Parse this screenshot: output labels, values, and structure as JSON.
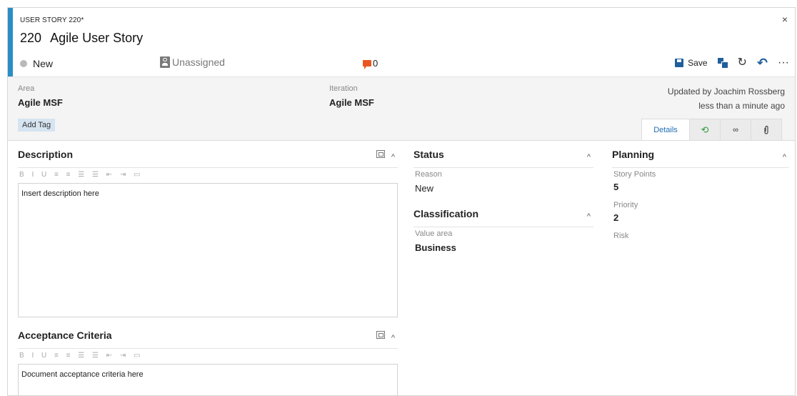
{
  "header": {
    "work_item_type": "USER STORY 220*",
    "close_glyph": "×",
    "id": "220",
    "title": "Agile User Story",
    "state": "New",
    "assigned_to": "Unassigned",
    "discussion_count": "0",
    "save_label": "Save",
    "refresh_glyph": "↻",
    "undo_glyph": "↶",
    "more_glyph": "···"
  },
  "meta": {
    "area_label": "Area",
    "area_value": "Agile MSF",
    "iteration_label": "Iteration",
    "iteration_value": "Agile MSF",
    "updated_by": "Updated by Joachim Rossberg",
    "updated_when": "less than a minute ago",
    "add_tag_label": "Add Tag"
  },
  "tabs": {
    "details": "Details",
    "history_glyph": "⟲",
    "links_glyph": "∞",
    "attachments_glyph": "⌕"
  },
  "description": {
    "title": "Description",
    "toolbar": "B I U ≡ ≡ ☰ ☰ ⇤ ⇥ ▭",
    "placeholder": "Insert description here"
  },
  "acceptance": {
    "title": "Acceptance Criteria",
    "toolbar": "B I U ≡ ≡ ☰ ☰ ⇤ ⇥ ▭",
    "placeholder": "Document acceptance criteria here"
  },
  "status": {
    "title": "Status",
    "reason_label": "Reason",
    "reason_value": "New"
  },
  "classification": {
    "title": "Classification",
    "value_area_label": "Value area",
    "value_area_value": "Business"
  },
  "planning": {
    "title": "Planning",
    "story_points_label": "Story Points",
    "story_points_value": "5",
    "priority_label": "Priority",
    "priority_value": "2",
    "risk_label": "Risk"
  },
  "colors": {
    "accent": "#2b8dc7",
    "discussion": "#e8571f",
    "link": "#1f6fb5",
    "tag_bg": "#d6e4f1"
  }
}
